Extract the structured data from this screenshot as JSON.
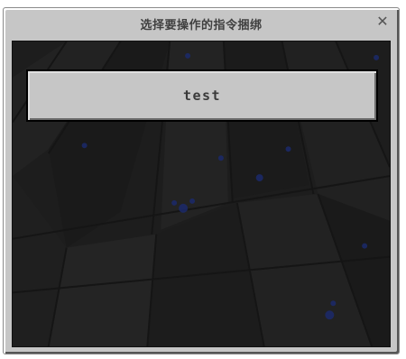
{
  "dialog": {
    "title": "选择要操作的指令捆绑",
    "close_icon": "close-icon"
  },
  "list": {
    "items": [
      {
        "label": "test"
      }
    ]
  },
  "colors": {
    "panel": "#c6c6c6",
    "content_bg": "#1c1c1c",
    "title_text": "#404040"
  }
}
